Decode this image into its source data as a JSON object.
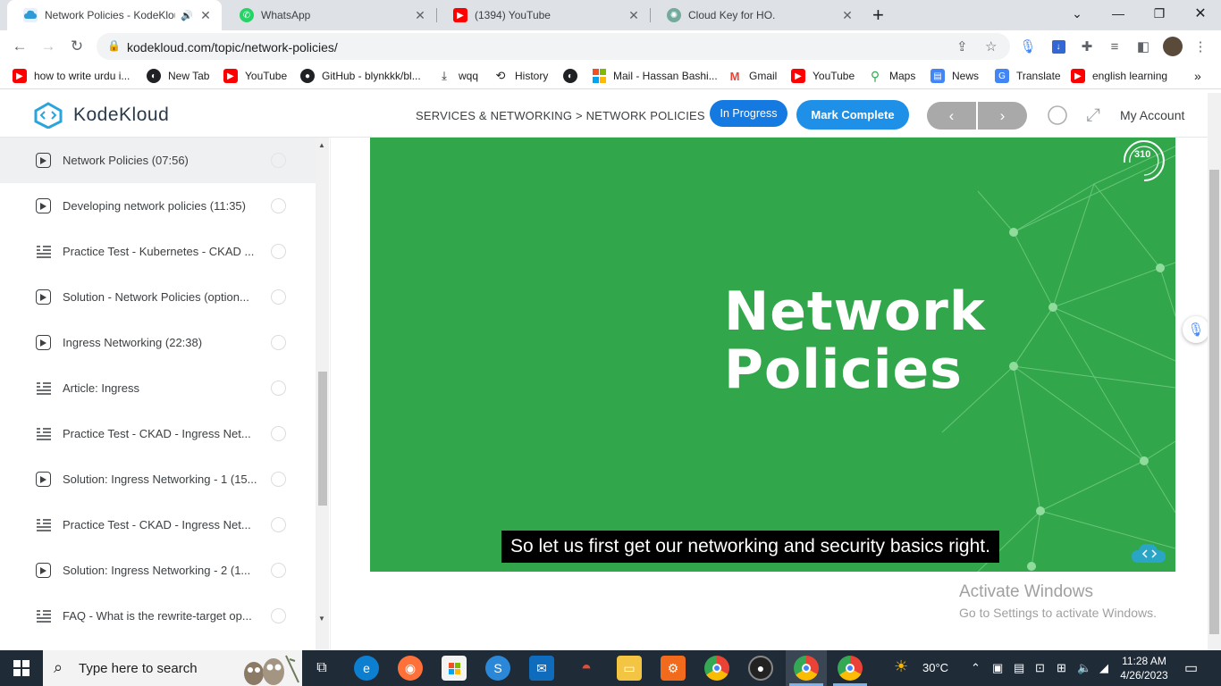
{
  "browser": {
    "tabs": [
      {
        "title": "Network Policies - KodeKlou",
        "favicon": "kodekloud-icon",
        "color": "#1e90e8",
        "active": true,
        "audio": true
      },
      {
        "title": "WhatsApp",
        "favicon": "whatsapp-icon",
        "color": "#25d366",
        "active": false
      },
      {
        "title": "(1394) YouTube",
        "favicon": "youtube-icon",
        "color": "#ff0000",
        "active": false
      },
      {
        "title": "Cloud Key for HO.",
        "favicon": "chatgpt-icon",
        "color": "#74aa9c",
        "active": false
      }
    ],
    "new_tab": "+",
    "url": "kodekloud.com/topic/network-policies/",
    "bookmarks": [
      {
        "label": "how to write urdu i...",
        "icon": "youtube-icon",
        "color": "#ff0000"
      },
      {
        "label": "New Tab",
        "icon": "globe-icon",
        "color": "#202124"
      },
      {
        "label": "YouTube",
        "icon": "youtube-icon",
        "color": "#ff0000"
      },
      {
        "label": "GitHub - blynkkk/bl...",
        "icon": "github-icon",
        "color": "#202124"
      },
      {
        "label": "wqq",
        "icon": "download-icon",
        "color": "#202124"
      },
      {
        "label": "History",
        "icon": "history-icon",
        "color": "#202124"
      },
      {
        "label": "",
        "icon": "globe-icon",
        "color": "#202124"
      },
      {
        "label": "Mail - Hassan Bashi...",
        "icon": "microsoft-icon",
        "color": "#f25022"
      },
      {
        "label": "Gmail",
        "icon": "gmail-icon",
        "color": "#ea4335"
      },
      {
        "label": "YouTube",
        "icon": "youtube-icon",
        "color": "#ff0000"
      },
      {
        "label": "Maps",
        "icon": "maps-icon",
        "color": "#34a853"
      },
      {
        "label": "News",
        "icon": "news-icon",
        "color": "#4285f4"
      },
      {
        "label": "Translate",
        "icon": "translate-icon",
        "color": "#4285f4"
      },
      {
        "label": "english learning",
        "icon": "youtube-icon",
        "color": "#ff0000"
      }
    ]
  },
  "site": {
    "logo_text": "KodeKloud",
    "breadcrumb": "SERVICES & NETWORKING > NETWORK POLICIES",
    "status_button": "In Progress",
    "complete_button": "Mark Complete",
    "prev": "‹",
    "next": "›",
    "account": "My Account",
    "accent": "#1e90e8"
  },
  "sidebar": {
    "lessons": [
      {
        "label": "Network Policies (07:56)",
        "type": "video",
        "current": true
      },
      {
        "label": "Developing network policies (11:35)",
        "type": "video"
      },
      {
        "label": "Practice Test - Kubernetes - CKAD ...",
        "type": "lab"
      },
      {
        "label": "Solution - Network Policies (option...",
        "type": "video"
      },
      {
        "label": "Ingress Networking (22:38)",
        "type": "video"
      },
      {
        "label": "Article: Ingress",
        "type": "lab"
      },
      {
        "label": "Practice Test - CKAD - Ingress Net...",
        "type": "lab"
      },
      {
        "label": "Solution: Ingress Networking - 1 (15...",
        "type": "video"
      },
      {
        "label": "Practice Test - CKAD - Ingress Net...",
        "type": "lab"
      },
      {
        "label": "Solution: Ingress Networking - 2 (1...",
        "type": "video"
      },
      {
        "label": "FAQ - What is the rewrite-target op...",
        "type": "lab"
      }
    ]
  },
  "video": {
    "title_line1": "Network",
    "title_line2": "Policies",
    "subtitle": "So let us first get our networking and security basics right.",
    "counter": "310",
    "background": "#32a64a"
  },
  "watermark": {
    "line1": "Activate Windows",
    "line2": "Go to Settings to activate Windows."
  },
  "taskbar": {
    "search_placeholder": "Type here to search",
    "temperature": "30°C",
    "time": "11:28 AM",
    "date": "4/26/2023"
  }
}
